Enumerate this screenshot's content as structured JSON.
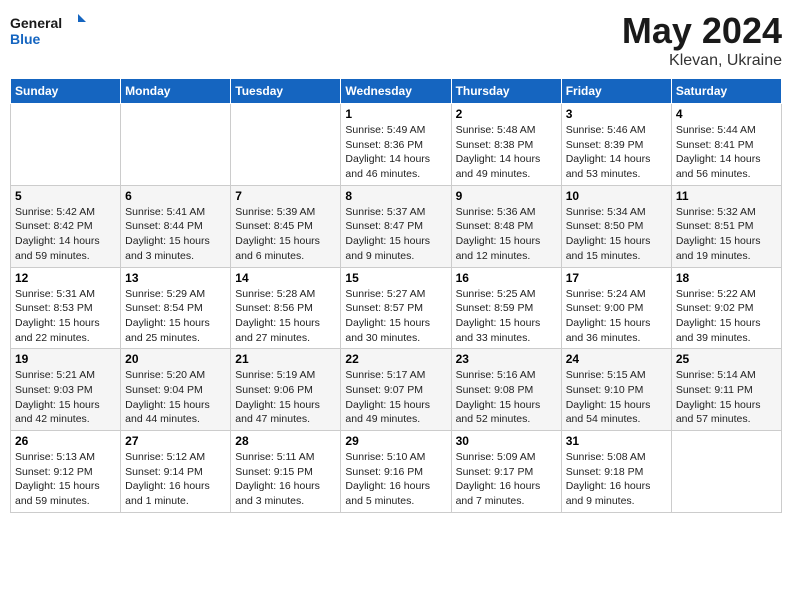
{
  "header": {
    "logo_line1": "General",
    "logo_line2": "Blue",
    "month": "May 2024",
    "location": "Klevan, Ukraine"
  },
  "weekdays": [
    "Sunday",
    "Monday",
    "Tuesday",
    "Wednesday",
    "Thursday",
    "Friday",
    "Saturday"
  ],
  "weeks": [
    [
      {
        "day": "",
        "info": ""
      },
      {
        "day": "",
        "info": ""
      },
      {
        "day": "",
        "info": ""
      },
      {
        "day": "1",
        "info": "Sunrise: 5:49 AM\nSunset: 8:36 PM\nDaylight: 14 hours\nand 46 minutes."
      },
      {
        "day": "2",
        "info": "Sunrise: 5:48 AM\nSunset: 8:38 PM\nDaylight: 14 hours\nand 49 minutes."
      },
      {
        "day": "3",
        "info": "Sunrise: 5:46 AM\nSunset: 8:39 PM\nDaylight: 14 hours\nand 53 minutes."
      },
      {
        "day": "4",
        "info": "Sunrise: 5:44 AM\nSunset: 8:41 PM\nDaylight: 14 hours\nand 56 minutes."
      }
    ],
    [
      {
        "day": "5",
        "info": "Sunrise: 5:42 AM\nSunset: 8:42 PM\nDaylight: 14 hours\nand 59 minutes."
      },
      {
        "day": "6",
        "info": "Sunrise: 5:41 AM\nSunset: 8:44 PM\nDaylight: 15 hours\nand 3 minutes."
      },
      {
        "day": "7",
        "info": "Sunrise: 5:39 AM\nSunset: 8:45 PM\nDaylight: 15 hours\nand 6 minutes."
      },
      {
        "day": "8",
        "info": "Sunrise: 5:37 AM\nSunset: 8:47 PM\nDaylight: 15 hours\nand 9 minutes."
      },
      {
        "day": "9",
        "info": "Sunrise: 5:36 AM\nSunset: 8:48 PM\nDaylight: 15 hours\nand 12 minutes."
      },
      {
        "day": "10",
        "info": "Sunrise: 5:34 AM\nSunset: 8:50 PM\nDaylight: 15 hours\nand 15 minutes."
      },
      {
        "day": "11",
        "info": "Sunrise: 5:32 AM\nSunset: 8:51 PM\nDaylight: 15 hours\nand 19 minutes."
      }
    ],
    [
      {
        "day": "12",
        "info": "Sunrise: 5:31 AM\nSunset: 8:53 PM\nDaylight: 15 hours\nand 22 minutes."
      },
      {
        "day": "13",
        "info": "Sunrise: 5:29 AM\nSunset: 8:54 PM\nDaylight: 15 hours\nand 25 minutes."
      },
      {
        "day": "14",
        "info": "Sunrise: 5:28 AM\nSunset: 8:56 PM\nDaylight: 15 hours\nand 27 minutes."
      },
      {
        "day": "15",
        "info": "Sunrise: 5:27 AM\nSunset: 8:57 PM\nDaylight: 15 hours\nand 30 minutes."
      },
      {
        "day": "16",
        "info": "Sunrise: 5:25 AM\nSunset: 8:59 PM\nDaylight: 15 hours\nand 33 minutes."
      },
      {
        "day": "17",
        "info": "Sunrise: 5:24 AM\nSunset: 9:00 PM\nDaylight: 15 hours\nand 36 minutes."
      },
      {
        "day": "18",
        "info": "Sunrise: 5:22 AM\nSunset: 9:02 PM\nDaylight: 15 hours\nand 39 minutes."
      }
    ],
    [
      {
        "day": "19",
        "info": "Sunrise: 5:21 AM\nSunset: 9:03 PM\nDaylight: 15 hours\nand 42 minutes."
      },
      {
        "day": "20",
        "info": "Sunrise: 5:20 AM\nSunset: 9:04 PM\nDaylight: 15 hours\nand 44 minutes."
      },
      {
        "day": "21",
        "info": "Sunrise: 5:19 AM\nSunset: 9:06 PM\nDaylight: 15 hours\nand 47 minutes."
      },
      {
        "day": "22",
        "info": "Sunrise: 5:17 AM\nSunset: 9:07 PM\nDaylight: 15 hours\nand 49 minutes."
      },
      {
        "day": "23",
        "info": "Sunrise: 5:16 AM\nSunset: 9:08 PM\nDaylight: 15 hours\nand 52 minutes."
      },
      {
        "day": "24",
        "info": "Sunrise: 5:15 AM\nSunset: 9:10 PM\nDaylight: 15 hours\nand 54 minutes."
      },
      {
        "day": "25",
        "info": "Sunrise: 5:14 AM\nSunset: 9:11 PM\nDaylight: 15 hours\nand 57 minutes."
      }
    ],
    [
      {
        "day": "26",
        "info": "Sunrise: 5:13 AM\nSunset: 9:12 PM\nDaylight: 15 hours\nand 59 minutes."
      },
      {
        "day": "27",
        "info": "Sunrise: 5:12 AM\nSunset: 9:14 PM\nDaylight: 16 hours\nand 1 minute."
      },
      {
        "day": "28",
        "info": "Sunrise: 5:11 AM\nSunset: 9:15 PM\nDaylight: 16 hours\nand 3 minutes."
      },
      {
        "day": "29",
        "info": "Sunrise: 5:10 AM\nSunset: 9:16 PM\nDaylight: 16 hours\nand 5 minutes."
      },
      {
        "day": "30",
        "info": "Sunrise: 5:09 AM\nSunset: 9:17 PM\nDaylight: 16 hours\nand 7 minutes."
      },
      {
        "day": "31",
        "info": "Sunrise: 5:08 AM\nSunset: 9:18 PM\nDaylight: 16 hours\nand 9 minutes."
      },
      {
        "day": "",
        "info": ""
      }
    ]
  ]
}
